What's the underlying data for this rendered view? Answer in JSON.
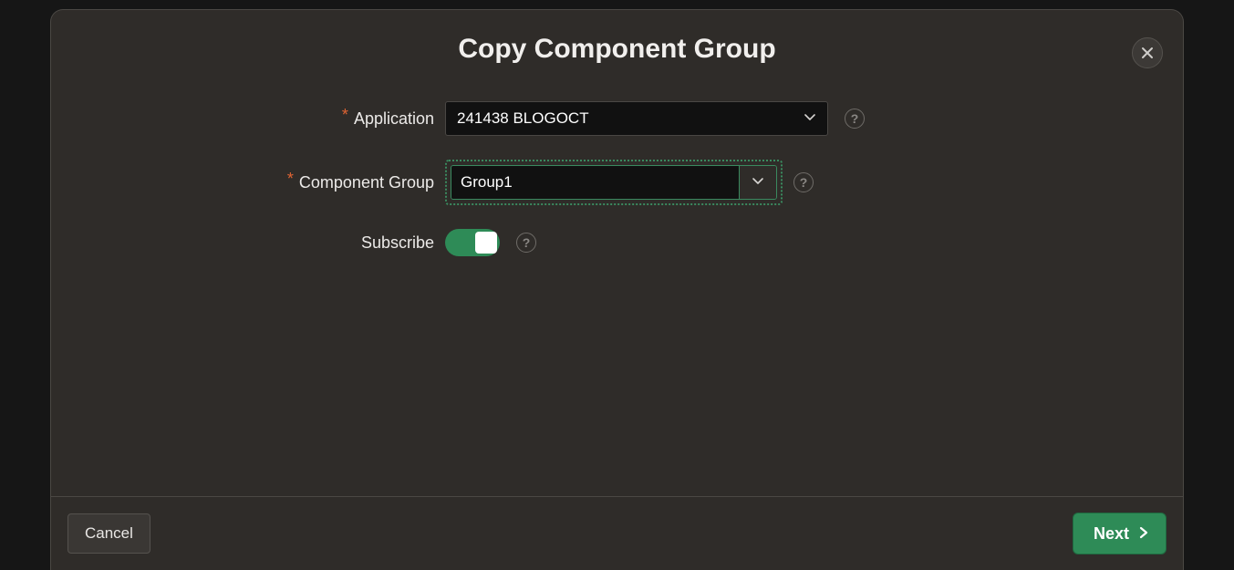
{
  "dialog": {
    "title": "Copy Component Group",
    "labels": {
      "application": "Application",
      "component_group": "Component Group",
      "subscribe": "Subscribe"
    },
    "values": {
      "application": "241438 BLOGOCT",
      "component_group": "Group1",
      "subscribe_on": true
    },
    "buttons": {
      "cancel": "Cancel",
      "next": "Next"
    }
  }
}
